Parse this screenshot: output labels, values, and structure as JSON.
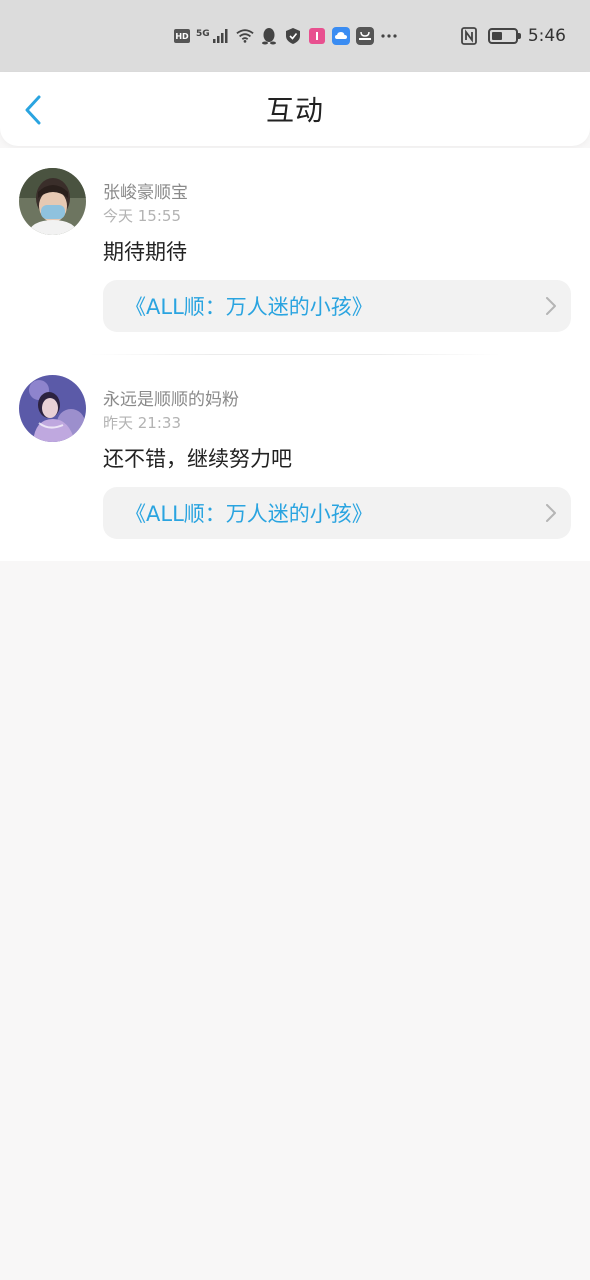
{
  "status_bar": {
    "time": "5:46",
    "network": "5G",
    "hd_label": "HD",
    "icons": [
      "hd-icon",
      "5g-signal-icon",
      "wifi-icon",
      "qq-icon",
      "shield-icon",
      "app-icon",
      "cloud-icon",
      "huawei-icon",
      "more-icon",
      "nfc-icon",
      "battery-icon"
    ]
  },
  "header": {
    "title": "互动",
    "back_icon": "chevron-left-icon"
  },
  "items": [
    {
      "author": "张峻豪顺宝",
      "time": "今天 15:55",
      "comment": "期待期待",
      "link": "《ALL顺：万人迷的小孩》"
    },
    {
      "author": "永远是顺顺的妈粉",
      "time": "昨天 21:33",
      "comment": "还不错，继续努力吧",
      "link": "《ALL顺：万人迷的小孩》"
    }
  ],
  "colors": {
    "accent": "#2aa4e0",
    "status_bar_bg": "#dcdcdc",
    "page_bg": "#f8f7f7"
  }
}
